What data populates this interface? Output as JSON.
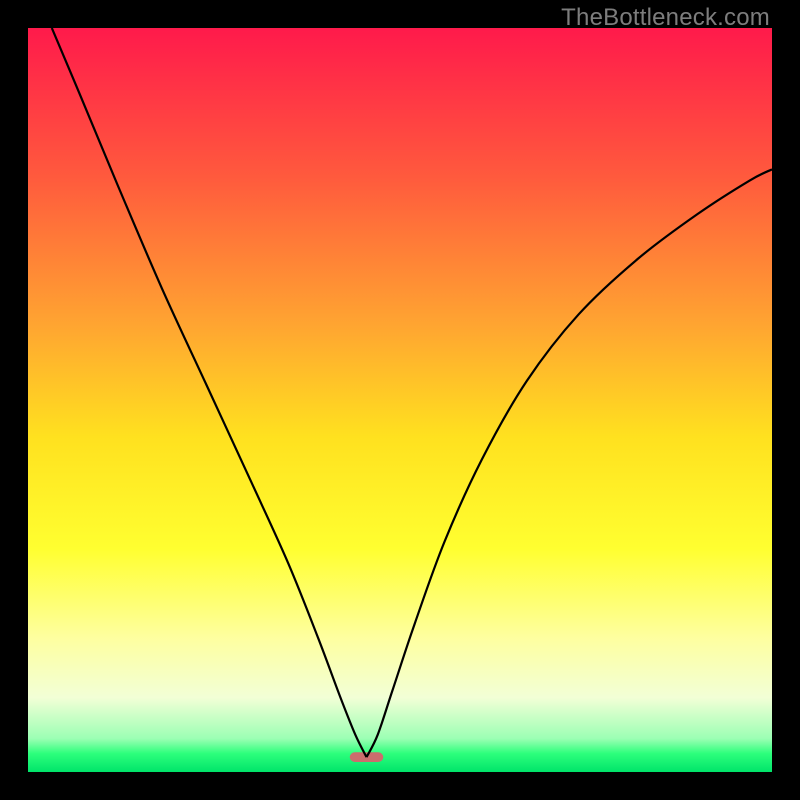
{
  "watermark": "TheBottleneck.com",
  "chart_data": {
    "type": "line",
    "title": "",
    "xlabel": "",
    "ylabel": "",
    "xlim": [
      0,
      100
    ],
    "ylim": [
      0,
      100
    ],
    "gradient_stops": [
      {
        "pos": 0.0,
        "color": "#ff1a4b"
      },
      {
        "pos": 0.2,
        "color": "#ff5a3d"
      },
      {
        "pos": 0.4,
        "color": "#ffa531"
      },
      {
        "pos": 0.55,
        "color": "#ffe11f"
      },
      {
        "pos": 0.7,
        "color": "#ffff30"
      },
      {
        "pos": 0.82,
        "color": "#feffa0"
      },
      {
        "pos": 0.9,
        "color": "#f2ffd6"
      },
      {
        "pos": 0.955,
        "color": "#9cffb4"
      },
      {
        "pos": 0.975,
        "color": "#2dff7c"
      },
      {
        "pos": 1.0,
        "color": "#00e46a"
      }
    ],
    "marker": {
      "x": 45.5,
      "y": 2.0,
      "w": 4.5,
      "h": 1.3,
      "color": "#cc6d6d"
    },
    "series": [
      {
        "name": "left-branch",
        "points": [
          {
            "x": 3.2,
            "y": 100.0
          },
          {
            "x": 7.0,
            "y": 91.0
          },
          {
            "x": 12.0,
            "y": 79.0
          },
          {
            "x": 18.0,
            "y": 65.0
          },
          {
            "x": 24.0,
            "y": 52.0
          },
          {
            "x": 30.0,
            "y": 39.0
          },
          {
            "x": 35.0,
            "y": 28.0
          },
          {
            "x": 39.0,
            "y": 18.0
          },
          {
            "x": 42.0,
            "y": 10.0
          },
          {
            "x": 44.0,
            "y": 5.0
          },
          {
            "x": 45.5,
            "y": 2.0
          }
        ]
      },
      {
        "name": "right-branch",
        "points": [
          {
            "x": 45.5,
            "y": 2.0
          },
          {
            "x": 47.0,
            "y": 5.0
          },
          {
            "x": 49.0,
            "y": 11.0
          },
          {
            "x": 52.0,
            "y": 20.0
          },
          {
            "x": 56.0,
            "y": 31.0
          },
          {
            "x": 61.0,
            "y": 42.0
          },
          {
            "x": 67.0,
            "y": 52.5
          },
          {
            "x": 74.0,
            "y": 61.5
          },
          {
            "x": 82.0,
            "y": 69.0
          },
          {
            "x": 90.0,
            "y": 75.0
          },
          {
            "x": 97.0,
            "y": 79.5
          },
          {
            "x": 100.0,
            "y": 81.0
          }
        ]
      }
    ]
  }
}
